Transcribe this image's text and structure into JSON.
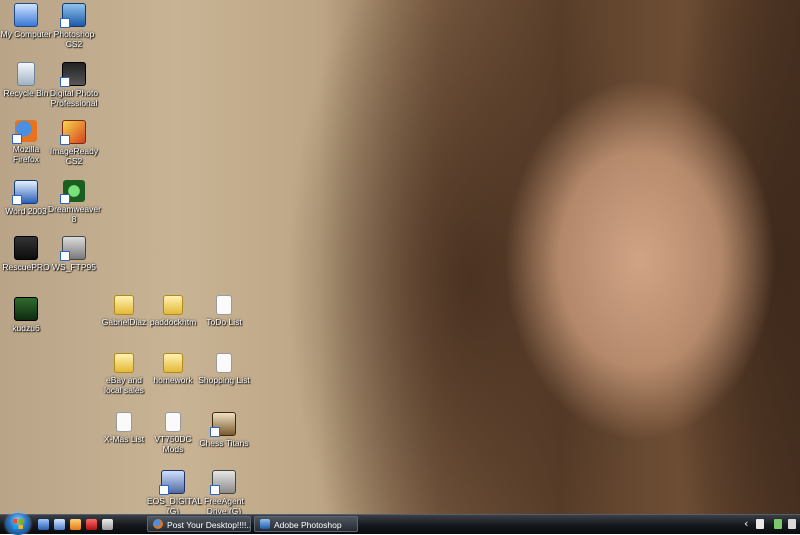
{
  "desktop": {
    "icons": [
      {
        "label": "My Computer",
        "icon": "computer-icon"
      },
      {
        "label": "Photoshop CS2",
        "icon": "photoshop-icon"
      },
      {
        "label": "Recycle Bin",
        "icon": "recycle-bin-icon"
      },
      {
        "label": "Digital Photo Professional",
        "icon": "digital-photo-professional-icon"
      },
      {
        "label": "Mozilla Firefox",
        "icon": "firefox-icon"
      },
      {
        "label": "ImageReady CS2",
        "icon": "imageready-icon"
      },
      {
        "label": "Word 2003",
        "icon": "word-icon"
      },
      {
        "label": "Dreamweaver 8",
        "icon": "dreamweaver-icon"
      },
      {
        "label": "RescuePRO",
        "icon": "rescuepro-icon"
      },
      {
        "label": "WS_FTP95",
        "icon": "ftp-icon"
      },
      {
        "label": "kudzu6",
        "icon": "kudzu-icon"
      },
      {
        "label": "GabrielDiaz",
        "icon": "folder-icon"
      },
      {
        "label": "paddockhtm",
        "icon": "folder-icon"
      },
      {
        "label": "ToDo List",
        "icon": "text-file-icon"
      },
      {
        "label": "eBay and local sales",
        "icon": "folder-icon"
      },
      {
        "label": "homework",
        "icon": "folder-icon"
      },
      {
        "label": "Shopping List",
        "icon": "text-file-icon"
      },
      {
        "label": "X-Mas List",
        "icon": "text-file-icon"
      },
      {
        "label": "VT750DC Mods",
        "icon": "text-file-icon"
      },
      {
        "label": "Chess Titans",
        "icon": "chess-icon"
      },
      {
        "label": "EOS_DIGITAL (G)",
        "icon": "drive-icon"
      },
      {
        "label": "FreeAgent Drive (G)",
        "icon": "drive-icon"
      }
    ]
  },
  "taskbar": {
    "start_icon": "windows-start-orb-icon",
    "quick_launch": [
      "show-desktop-icon",
      "switch-windows-icon",
      "media-player-icon",
      "flash-icon",
      "browser-icon"
    ],
    "tasks": [
      {
        "label": "Post Your Desktop!!!!...",
        "icon": "firefox-icon"
      },
      {
        "label": "Adobe Photoshop",
        "icon": "photoshop-icon"
      }
    ],
    "tray": {
      "chevron": "‹",
      "icons": [
        "network-icon",
        "volume-icon",
        "safely-remove-icon"
      ]
    }
  },
  "colors": {
    "taskbar": "#14171b",
    "label_text": "#ffffff",
    "start_orb": "#2a78c8"
  }
}
